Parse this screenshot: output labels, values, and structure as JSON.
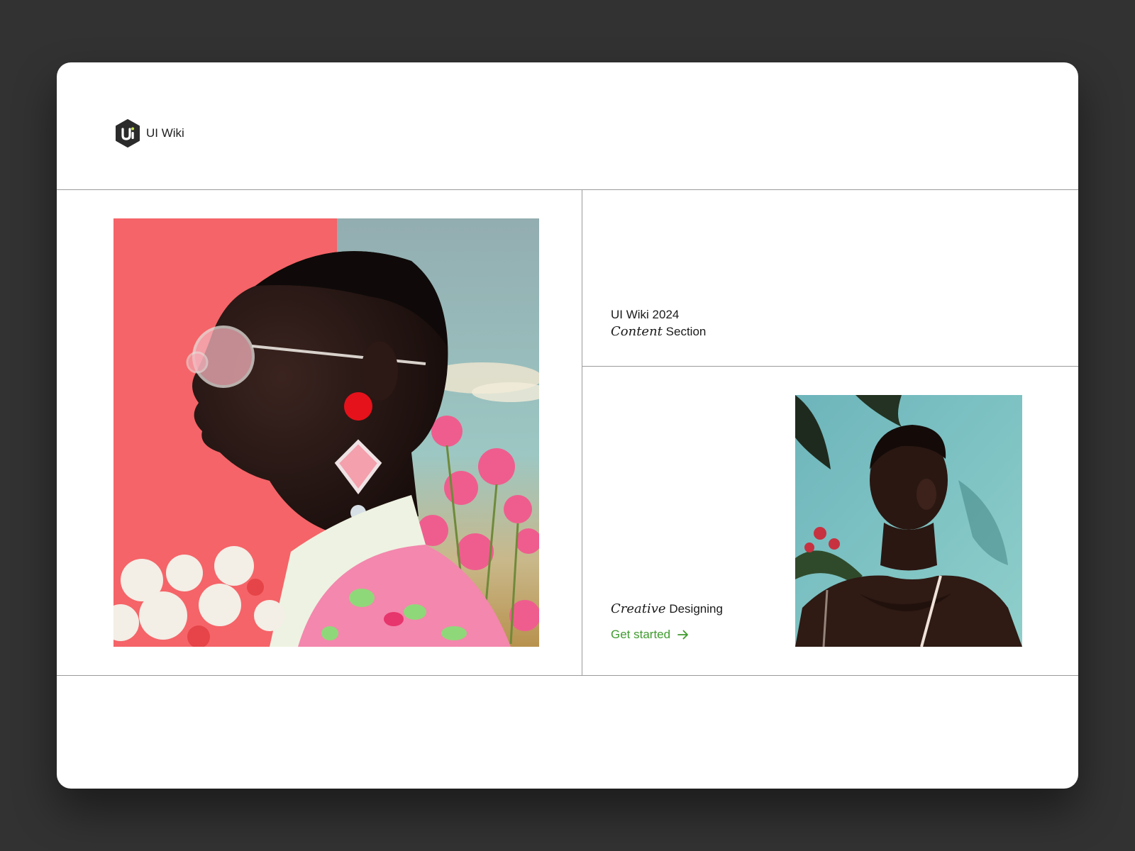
{
  "brand": {
    "name": "UI Wiki",
    "logo_letter": "ui"
  },
  "section": {
    "year_title": "UI Wiki 2024",
    "subtitle_italic": "Content",
    "subtitle_rest": "Section"
  },
  "feature": {
    "title_italic": "Creative",
    "title_rest": "Designing",
    "cta_label": "Get started",
    "cta_icon": "arrow-right-icon"
  },
  "colors": {
    "background": "#323232",
    "card": "#ffffff",
    "accent_green": "#3f9b2e",
    "divider": "#9a9a9a"
  }
}
